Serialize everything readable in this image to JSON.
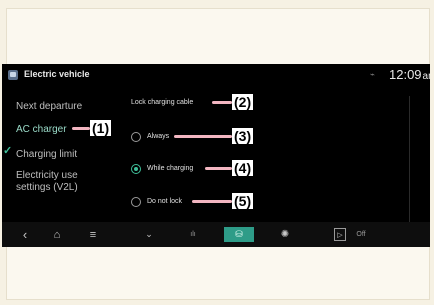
{
  "header": {
    "app_title": "Electric vehicle",
    "time": "12:09",
    "time_suffix": "am",
    "app_icon": "ev-app-icon",
    "status_icon": "signal-icon"
  },
  "sidebar": {
    "items": [
      {
        "label": "Next departure",
        "active": false
      },
      {
        "label": "AC charger",
        "active": true
      },
      {
        "label": "Charging limit",
        "active": false
      },
      {
        "label": "Electricity use settings (V2L)",
        "line1": "Electricity use",
        "line2": "settings (V2L)",
        "active": false
      }
    ],
    "active_marker": "check-icon",
    "active_color": "#3fbf9a"
  },
  "main": {
    "heading": "Lock charging cable",
    "options": [
      {
        "label": "Always",
        "selected": false
      },
      {
        "label": "While charging",
        "selected": true
      },
      {
        "label": "Do not lock",
        "selected": false
      }
    ]
  },
  "callouts": [
    "(1)",
    "(2)",
    "(3)",
    "(4)",
    "(5)"
  ],
  "navbar": {
    "items": [
      {
        "icon": "back-icon",
        "glyph": "‹"
      },
      {
        "icon": "home-icon",
        "glyph": "⌂"
      },
      {
        "icon": "menu-icon",
        "glyph": "≡"
      },
      {
        "icon": "climate-icon",
        "glyph": "⌄"
      },
      {
        "icon": "energy-icon",
        "glyph": "ılı"
      },
      {
        "icon": "ev-charge-icon",
        "glyph": "⛁"
      },
      {
        "icon": "settings-icon",
        "glyph": "✺"
      },
      {
        "icon": "play-icon",
        "glyph": "▷"
      }
    ],
    "off_label": "Off",
    "accent": "#2e9c88"
  }
}
